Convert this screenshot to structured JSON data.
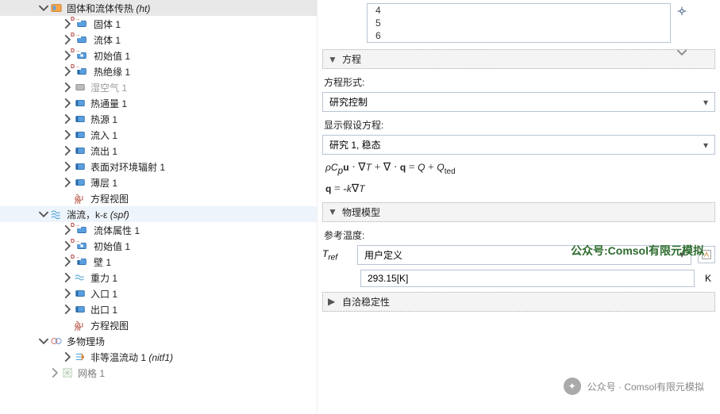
{
  "tree": {
    "ht": {
      "label": "固体和流体传热 ",
      "italic": "(ht)"
    },
    "ht_children": [
      {
        "label": "固体 1",
        "icon": "solid",
        "badge": true
      },
      {
        "label": "流体 1",
        "icon": "solid",
        "badge": true
      },
      {
        "label": "初始值 1",
        "icon": "init",
        "badge": true
      },
      {
        "label": "热绝缘 1",
        "icon": "bnd",
        "badge": true
      },
      {
        "label": "湿空气 1",
        "icon": "solid-dim",
        "dim": true
      },
      {
        "label": "热通量 1",
        "icon": "bnd"
      },
      {
        "label": "热源 1",
        "icon": "bnd"
      },
      {
        "label": "流入 1",
        "icon": "bnd"
      },
      {
        "label": "流出 1",
        "icon": "bnd"
      },
      {
        "label": "表面对环境辐射 1",
        "icon": "bnd"
      },
      {
        "label": "薄层 1",
        "icon": "bnd"
      },
      {
        "label": "方程视图",
        "icon": "eqview"
      }
    ],
    "spf": {
      "label": "湍流，k-ε ",
      "italic": "(spf)"
    },
    "spf_children": [
      {
        "label": "流体属性 1",
        "icon": "solid",
        "badge": true
      },
      {
        "label": "初始值 1",
        "icon": "init",
        "badge": true
      },
      {
        "label": "壁 1",
        "icon": "bnd",
        "badge": true
      },
      {
        "label": "重力 1",
        "icon": "wavy"
      },
      {
        "label": "入口 1",
        "icon": "bnd"
      },
      {
        "label": "出口 1",
        "icon": "bnd"
      },
      {
        "label": "方程视图",
        "icon": "eqview"
      }
    ],
    "multi": {
      "label": "多物理场"
    },
    "multi_children": [
      {
        "label": "非等温流动 1 ",
        "italic": "(nitf1)",
        "icon": "flow"
      }
    ],
    "mesh": {
      "label": "网格 1"
    }
  },
  "listbox": {
    "rows": [
      "4",
      "5",
      "6"
    ]
  },
  "sections": {
    "equation": "方程",
    "physmodel": "物理模型",
    "selfcons": "自洽稳定性"
  },
  "labels": {
    "eq_form": "方程形式:",
    "show_assumed": "显示假设方程:",
    "ref_temp": "参考温度:",
    "tref": "T ref",
    "unit_k": "K"
  },
  "selects": {
    "eq_form_value": "研究控制",
    "show_assumed_value": "研究 1, 稳态",
    "tref_select_value": "用户定义"
  },
  "inputs": {
    "tref_value": "293.15[K]"
  },
  "equations": {
    "eq1": "ρCₚu · ∇T + ∇ · q = Q + Q",
    "eq1_sub": "ted",
    "eq2": "q = -k∇T"
  },
  "watermark1": "公众号:Comsol有限元模拟",
  "watermark2": "公众号 · Comsol有限元模拟"
}
